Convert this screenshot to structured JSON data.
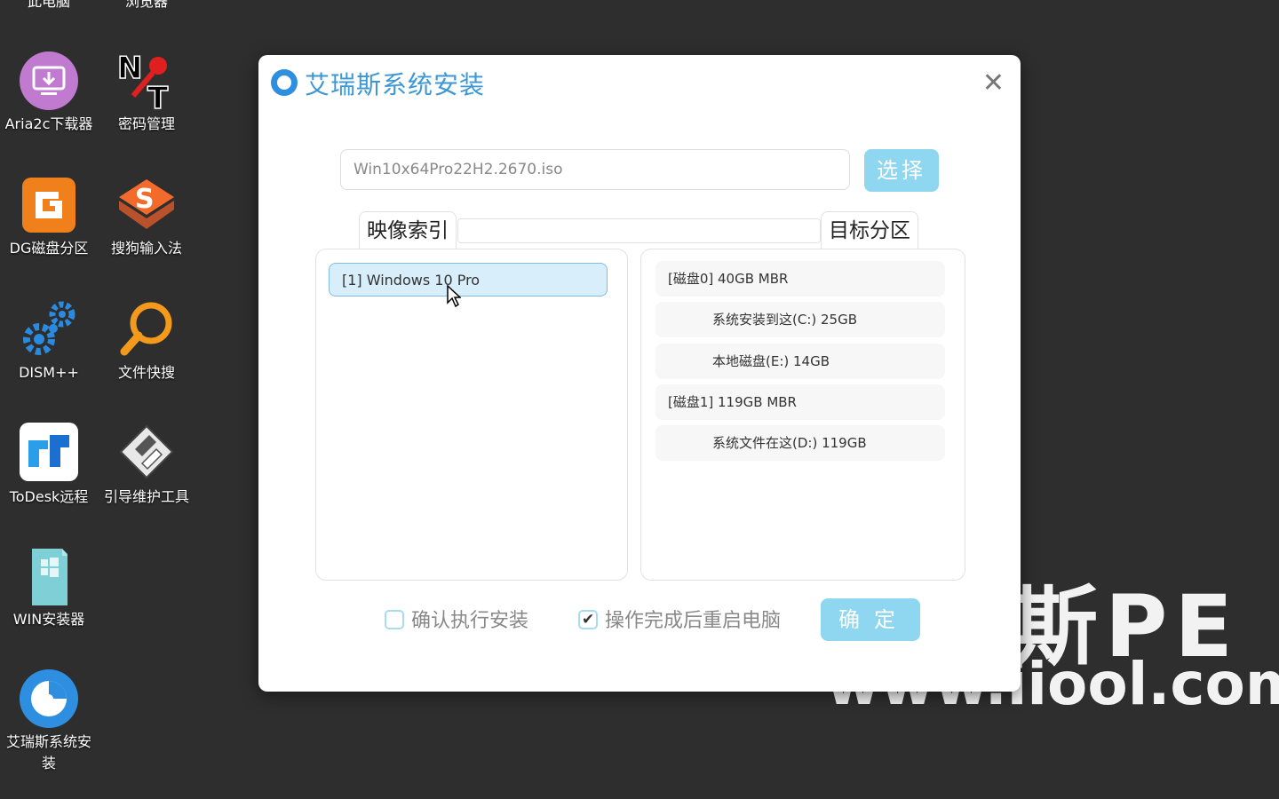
{
  "desktop": {
    "top_labels": [
      "此电脑",
      "浏览器"
    ],
    "icons": [
      {
        "label": "Aria2c下载器",
        "icon": "download-icon"
      },
      {
        "label": "密码管理",
        "icon": "key-icon"
      },
      {
        "label": "DG磁盘分区",
        "icon": "dg-disk-icon"
      },
      {
        "label": "搜狗输入法",
        "icon": "sogou-icon"
      },
      {
        "label": "DISM++",
        "icon": "gears-icon"
      },
      {
        "label": "文件快搜",
        "icon": "magnifier-icon"
      },
      {
        "label": "ToDesk远程",
        "icon": "todesk-icon"
      },
      {
        "label": "引导维护工具",
        "icon": "floppy-icon"
      },
      {
        "label": "WIN安装器",
        "icon": "win-installer-icon"
      },
      {
        "label": "艾瑞斯系统安\n装",
        "icon": "airuisi-icon"
      }
    ]
  },
  "watermark": {
    "line1": "斯PE",
    "line2": "www.iiool.com"
  },
  "dialog": {
    "title": "艾瑞斯系统安装",
    "close_glyph": "✕",
    "iso_value": "Win10x64Pro22H2.2670.iso",
    "select_button": "选择",
    "tab_image_index": "映像索引",
    "tab_target_partition": "目标分区",
    "images": [
      "[1] Windows 10 Pro"
    ],
    "partitions": [
      {
        "text": "[磁盘0]  40GB  MBR",
        "kind": "disk"
      },
      {
        "text": "系统安装到这(C:) 25GB",
        "kind": "sub"
      },
      {
        "text": "本地磁盘(E:) 14GB",
        "kind": "sub"
      },
      {
        "text": "[磁盘1]  119GB  MBR",
        "kind": "disk"
      },
      {
        "text": "系统文件在这(D:) 119GB",
        "kind": "sub"
      }
    ],
    "confirm_install_label": "确认执行安装",
    "confirm_install_checked": false,
    "restart_label": "操作完成后重启电脑",
    "restart_checked": true,
    "ok_button": "确定"
  },
  "colors": {
    "accent": "#8fd6f0",
    "title": "#3c97d6",
    "desktop_bg": "#2e2e2e"
  }
}
